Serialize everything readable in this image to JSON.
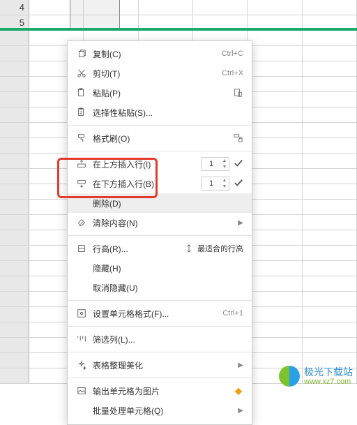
{
  "rows_top": [
    "4",
    "5"
  ],
  "menu": {
    "copy": "复制(C)",
    "copy_sc": "Ctrl+C",
    "cut": "剪切(T)",
    "cut_sc": "Ctrl+X",
    "paste": "粘贴(P)",
    "paste_special": "选择性粘贴(S)...",
    "format_painter": "格式刷(O)",
    "insert_above": "在上方插入行(I)",
    "insert_above_val": "1",
    "insert_below": "在下方插入行(B)",
    "insert_below_val": "1",
    "delete": "删除(D)",
    "clear": "清除内容(N)",
    "row_height": "行高(R)...",
    "best_row_height": "最适合的行高",
    "hide": "隐藏(H)",
    "unhide": "取消隐藏(U)",
    "cell_format": "设置单元格格式(F)...",
    "cell_format_sc": "Ctrl+1",
    "filter_col": "筛选列(L)...",
    "table_style": "表格整理美化",
    "export_img": "输出单元格为图片",
    "batch_cell": "批量处理单元格(Q)"
  },
  "watermark": {
    "top": "极光下载站",
    "bot": "www.xz7.com"
  },
  "colors": {
    "highlight": "#e23b2e",
    "sel_green": "#1aaa6e"
  }
}
